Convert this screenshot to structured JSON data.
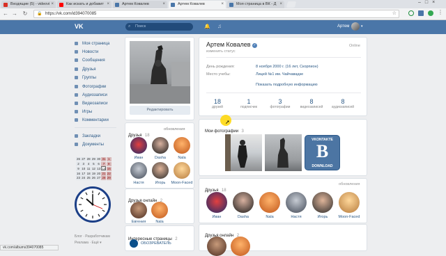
{
  "browser": {
    "tabs": [
      {
        "title": "Входящие (5) - videovi",
        "color": "#d93025"
      },
      {
        "title": "Как искать и добавит",
        "color": "#ff0000"
      },
      {
        "title": "Артем Ковалев",
        "color": "#4a76a8"
      },
      {
        "title": "Артем Ковалев",
        "color": "#4a76a8"
      },
      {
        "title": "Моя страница в ВК - Д",
        "color": "#4a76a8"
      }
    ],
    "url": "https://vk.com/id394070085",
    "status_url": "vk.com/albums394070085"
  },
  "header": {
    "logo": "VK",
    "search_placeholder": "Поиск",
    "user_name": "Артем"
  },
  "sidebar": {
    "items": [
      {
        "label": "Моя страница",
        "icon": "home-icon"
      },
      {
        "label": "Новости",
        "icon": "news-icon"
      },
      {
        "label": "Сообщения",
        "icon": "messages-icon"
      },
      {
        "label": "Друзья",
        "icon": "friends-icon"
      },
      {
        "label": "Группы",
        "icon": "groups-icon"
      },
      {
        "label": "Фотографии",
        "icon": "photos-icon"
      },
      {
        "label": "Аудиозаписи",
        "icon": "music-icon"
      },
      {
        "label": "Видеозаписи",
        "icon": "video-icon"
      },
      {
        "label": "Игры",
        "icon": "games-icon"
      },
      {
        "label": "Комментарии",
        "icon": "comments-icon"
      }
    ],
    "items2": [
      {
        "label": "Закладки",
        "icon": "bookmark-icon"
      },
      {
        "label": "Документы",
        "icon": "docs-icon"
      }
    ],
    "footer": [
      "Блог",
      "Разработчикам",
      "Реклама",
      "Ещё"
    ]
  },
  "profile": {
    "edit_button": "Редактировать",
    "name": "Артем Ковалев",
    "status_placeholder": "изменить статус",
    "online": "Online",
    "birthday_label": "День рождения:",
    "birthday_value": "8 ноября 2000 г. (16 лет, Скорпион)",
    "study_label": "Место учебы:",
    "study_value": "Лицей №1 им. Чайчавадзе",
    "more_info": "Показать подробную информацию",
    "counters": [
      {
        "n": "18",
        "l": "друзей"
      },
      {
        "n": "1",
        "l": "подписчик"
      },
      {
        "n": "3",
        "l": "фотографии"
      },
      {
        "n": "8",
        "l": "видеозаписей"
      },
      {
        "n": "8",
        "l": "аудиозаписей"
      }
    ]
  },
  "friends_block": {
    "title": "Друзья",
    "count": "18",
    "updates": "обновления",
    "people": [
      "Иван",
      "Dasha",
      "Nala",
      "Настя",
      "Игорь",
      "Moon-Faced"
    ]
  },
  "friends_online": {
    "title": "Друзья онлайн",
    "count": "2",
    "people": [
      "Евгения",
      "Nala"
    ]
  },
  "interesting": {
    "title": "Интересные страницы",
    "count": "2",
    "first": "ОБОЗРЕВАТЕЛЬ"
  },
  "photos": {
    "title": "Мои фотографии",
    "count": "3",
    "vk_logo_line1": "VKONTAKTE",
    "vk_logo_line2": "DOWNLOAD"
  },
  "friends_main": {
    "title": "Друзья",
    "count": "18",
    "updates": "обновления",
    "people": [
      "Иван",
      "Dasha",
      "Nala",
      "Настя",
      "Игорь",
      "Moon-Faced"
    ]
  },
  "friends_online_main": {
    "title": "Друзья онлайн",
    "count": "2"
  },
  "calendar": {
    "rows": [
      [
        "26",
        "27",
        "28",
        "29",
        "30",
        "31",
        "1"
      ],
      [
        "2",
        "3",
        "4",
        "5",
        "6",
        "7",
        "8"
      ],
      [
        "9",
        "10",
        "11",
        "12",
        "13",
        "14",
        "15"
      ],
      [
        "16",
        "17",
        "18",
        "19",
        "20",
        "21",
        "22"
      ],
      [
        "23",
        "24",
        "25",
        "26",
        "27",
        "28",
        "29"
      ]
    ],
    "today": "14"
  },
  "colors": {
    "vk_blue": "#4a76a8",
    "link": "#2a5885"
  }
}
